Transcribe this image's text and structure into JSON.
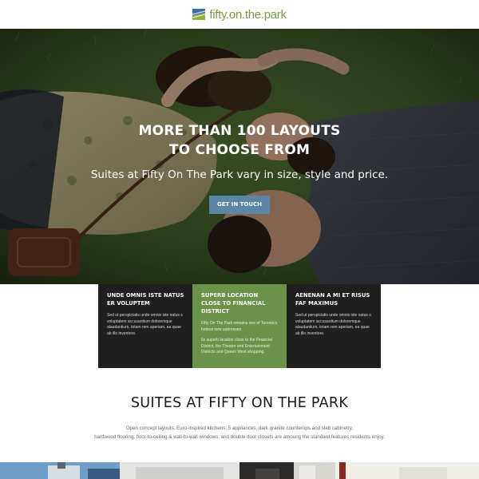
{
  "header": {
    "logo_text": "fifty.on.the.park",
    "logo_icon": "flag-logo-icon",
    "brand_color": "#7a9a45"
  },
  "hero": {
    "title_line1": "MORE THAN 100 LAYOUTS",
    "title_line2": "TO CHOOSE FROM",
    "subtitle": "Suites at Fifty On The Park vary in size, style and price.",
    "button_label": "GET IN TOUCH",
    "button_color": "#5b86a6"
  },
  "features": [
    {
      "title": "UNDE OMNIS ISTE NATUS ER VOLUPTEM",
      "paragraphs": [
        "Sed ut perspiciatis unde omnis iste natus s voluptatem accusantium doloremque alaudantium, totam rem aperiam, ea quae ab illo inventore."
      ],
      "color": "#1f1f1f"
    },
    {
      "title": "SUPERB LOCATION CLOSE TO FINANCIAL DISTRICT",
      "paragraphs": [
        "Fifty On The Park remains one of Toronto's hottest new addresses.",
        "Its superb location close to the Financial District, the Theatre and Entertainment Districts and Queen West shopping."
      ],
      "color": "#6b9249"
    },
    {
      "title": "AENENAN A MI ET RISUS FAF MAXIMUS",
      "paragraphs": [
        "Sed ut perspiciatis unde omnis iste natus s voluptatem accusantium doloremque alaudantium, totam rem aperiam, ea quae ab illo inventore."
      ],
      "color": "#1f1f1f"
    }
  ],
  "suites": {
    "title": "SUITES AT FIFTY ON THE PARK",
    "text_line1": "Open concept layouts, Euro-inspired kitchens, 5 appliances, dark granite counterops and slab cabinetry,",
    "text_line2": "hardwood flooring, floor-to-ceiling & wall-to-wall windows, and double door closets are amoung the standard features residents enjoy."
  }
}
